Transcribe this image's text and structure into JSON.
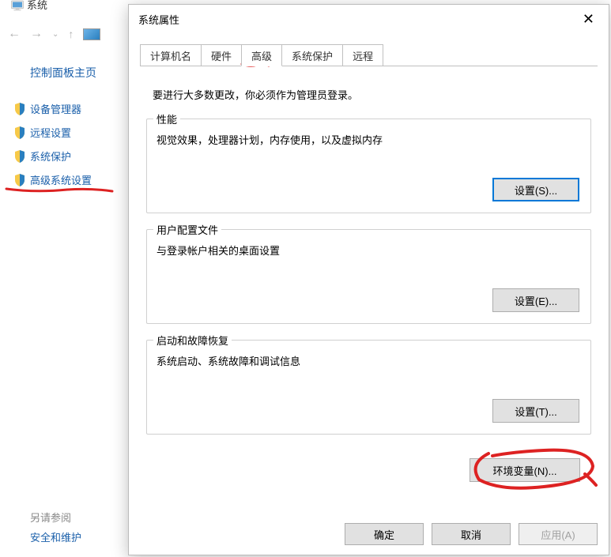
{
  "leftPanel": {
    "truncatedTitle": "系统",
    "controlPanelHome": "控制面板主页",
    "links": [
      {
        "label": "设备管理器"
      },
      {
        "label": "远程设置"
      },
      {
        "label": "系统保护"
      },
      {
        "label": "高级系统设置"
      }
    ],
    "seeAlso": "另请参阅",
    "securityMaintenance": "安全和维护"
  },
  "dialog": {
    "title": "系统属性",
    "tabs": {
      "computerName": "计算机名",
      "hardware": "硬件",
      "advanced": "高级",
      "systemProtection": "系统保护",
      "remote": "远程"
    },
    "adminNote": "要进行大多数更改，你必须作为管理员登录。",
    "group1": {
      "legend": "性能",
      "desc": "视觉效果，处理器计划，内存使用，以及虚拟内存",
      "button": "设置(S)..."
    },
    "group2": {
      "legend": "用户配置文件",
      "desc": "与登录帐户相关的桌面设置",
      "button": "设置(E)..."
    },
    "group3": {
      "legend": "启动和故障恢复",
      "desc": "系统启动、系统故障和调试信息",
      "button": "设置(T)..."
    },
    "envButton": "环境变量(N)...",
    "buttons": {
      "ok": "确定",
      "cancel": "取消",
      "apply": "应用(A)"
    }
  }
}
